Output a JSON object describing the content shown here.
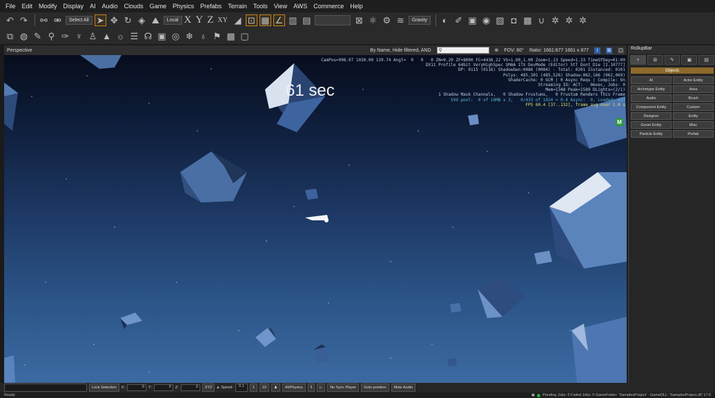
{
  "menu": [
    "File",
    "Edit",
    "Modify",
    "Display",
    "AI",
    "Audio",
    "Clouds",
    "Game",
    "Physics",
    "Prefabs",
    "Terrain",
    "Tools",
    "View",
    "AWS",
    "Commerce",
    "Help"
  ],
  "toolbar1": {
    "select_all": "Select All",
    "coord_system": "Local",
    "axes": [
      "X",
      "Y",
      "Z",
      "XY"
    ],
    "gravity": "Gravity"
  },
  "viewport": {
    "title": "Perspective",
    "filter_text": "By Name, Hide filtered, AND",
    "search_placeholder": "",
    "fov": "FOV:  60°",
    "ratio": "Ratio: 1661:877   1661 x 877",
    "timer": "61 sec",
    "badge": "M",
    "debug_lines": [
      "CamPos=998.07 1030.00 139.74 Angl=  0   0   0 ZN=0.20 ZF=8000 FC=4438.22 VS=1.00,1.00 Zoom=1.13 Speed=1.33 TimeOfDay=01:00",
      "DX11 Profile 64bit VeryHighSpec SMAA 1TX DevMode (Editor) StT Dont_Die [2.10777]",
      "DP: 0115 (0116) ShadowGen:0086 (0084) - Total: 0201 Instanced: 0101",
      "Polys: 485,301 (485,526) Shadow:062,166 (062,069)",
      "ShaderCache: 0 GCM | 0 Async Reqs | Compile: On",
      "Streaming IO: ACT:   0msec, Jobs: 0",
      "Mem=1348 Peak=1589 DLights=(2/1)",
      "1 Shadow Mask Channels,   0 Shadow Frustums,   0 Frustum Renders This Frame",
      "SVO pool:  0 of 10MB x 3,   0/433 of 1024 = 0.4 Async:  0, Loaded: 437",
      "FPS 60.4 [37..132], frame avg over 1.0 s"
    ]
  },
  "rollup": {
    "title": "RollupBar",
    "tabs": [
      "+",
      "⊞",
      "✎",
      "▣",
      "▤"
    ],
    "objects_label": "Objects",
    "buttons": [
      "AI",
      "Actor Entity",
      "Archetype Entity",
      "Area",
      "Audio",
      "Brush",
      "Component Entity",
      "Custom",
      "Designer",
      "Entity",
      "Geom Entity",
      "Misc",
      "Particle Entity",
      "Prefab"
    ]
  },
  "controls": {
    "lock_selection": "Lock Selection",
    "x_label": "X:",
    "x_value": "0",
    "y_label": "Y:",
    "y_value": "0",
    "z_label": "Z:",
    "z_value": "0",
    "xyz": "XYZ",
    "speed_label": "Speed:",
    "speed_value": "0.1",
    "speed_steps": [
      "1",
      "10"
    ],
    "ai_physics": "AI/Physics",
    "no_sync": "No Sync Player",
    "goto_position": "Goto position",
    "mute_audio": "Mute Audio"
  },
  "status": {
    "left": "Ready",
    "right": "Pending Jobs: 0  Failed Jobs: 0  GameFolder: 'SamplesProject' - GameDLL: 'SamplesProject.dll'  17:0"
  }
}
